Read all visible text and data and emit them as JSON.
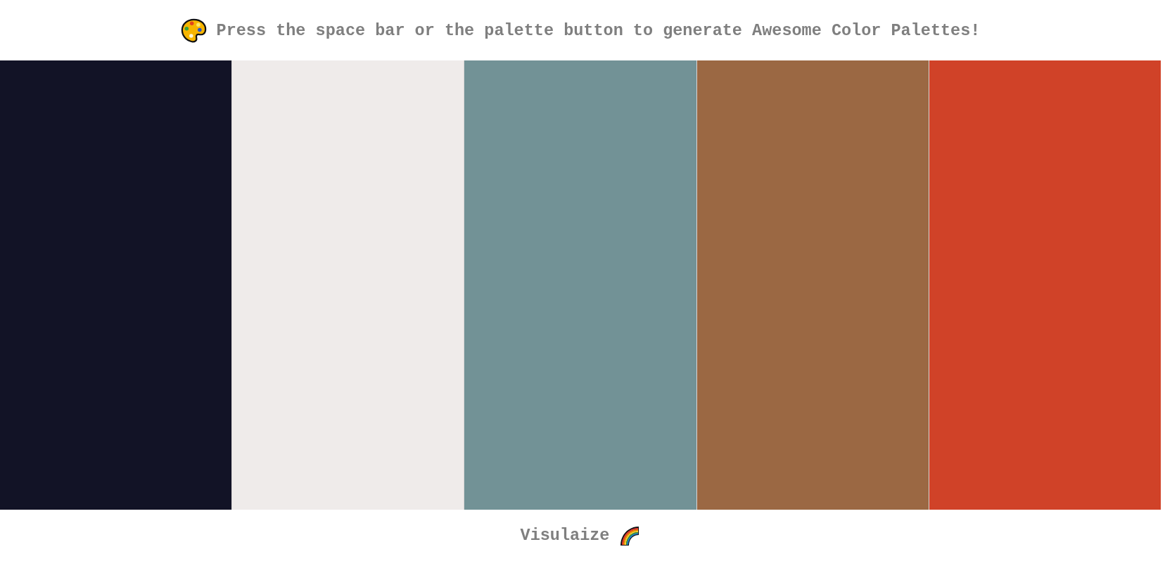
{
  "header": {
    "message": "Press the space bar or the palette button to generate Awesome Color Palettes!"
  },
  "swatches": [
    {
      "color": "#121326"
    },
    {
      "color": "#efebea"
    },
    {
      "color": "#729296"
    },
    {
      "color": "#9b6843"
    },
    {
      "color": "#d04228"
    }
  ],
  "footer": {
    "link": "Visulaize"
  }
}
